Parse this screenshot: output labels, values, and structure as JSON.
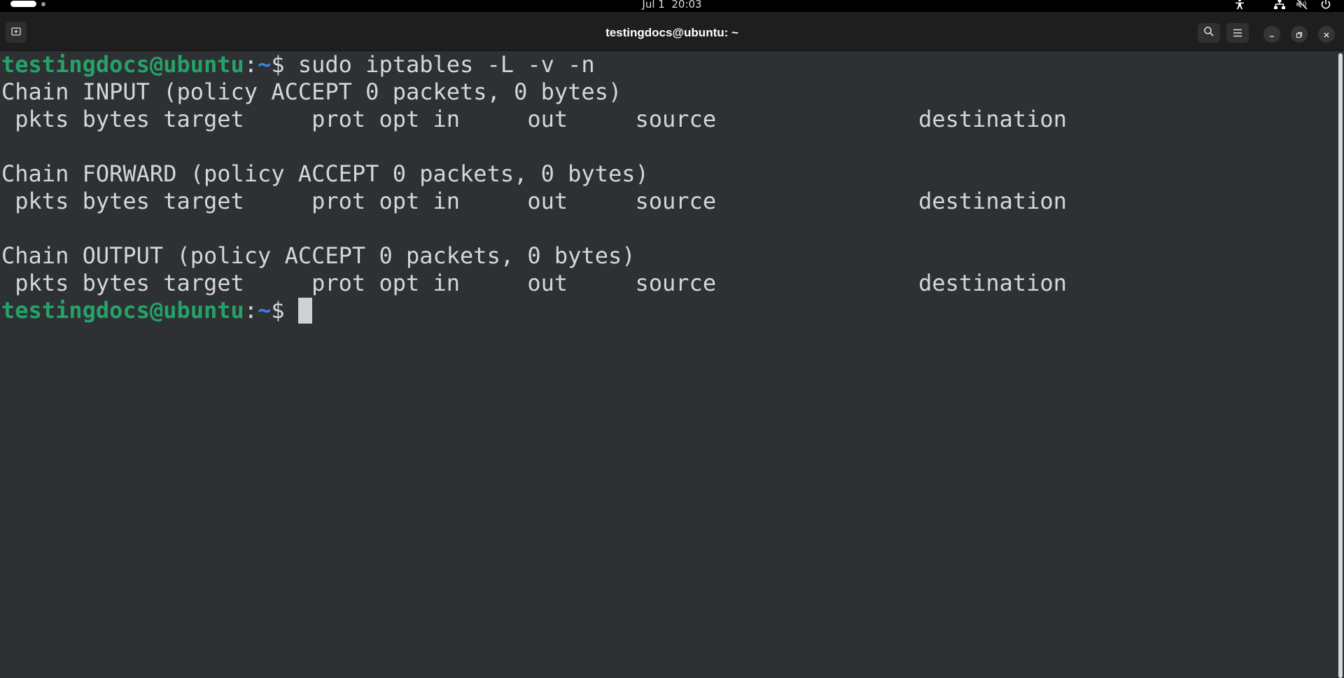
{
  "topbar": {
    "clock": "Jul 1  20:03",
    "tray_icons": [
      "accessibility-icon",
      "network-icon",
      "volume-muted-icon",
      "power-icon"
    ]
  },
  "window": {
    "title": "testingdocs@ubuntu: ~",
    "buttons": [
      "new-tab-icon",
      "search-icon",
      "menu-icon",
      "minimize-icon",
      "restore-icon",
      "close-icon"
    ]
  },
  "terminal": {
    "prompt": {
      "user_host": "testingdocs@ubuntu",
      "colon": ":",
      "path": "~",
      "symbol": "$ "
    },
    "command": "sudo iptables -L -v -n",
    "output": [
      "Chain INPUT (policy ACCEPT 0 packets, 0 bytes)",
      " pkts bytes target     prot opt in     out     source               destination",
      "",
      "Chain FORWARD (policy ACCEPT 0 packets, 0 bytes)",
      " pkts bytes target     prot opt in     out     source               destination",
      "",
      "Chain OUTPUT (policy ACCEPT 0 packets, 0 bytes)",
      " pkts bytes target     prot opt in     out     source               destination"
    ]
  },
  "colors": {
    "terminal_bg": "#2d3134",
    "terminal_fg": "#d6d6d6",
    "prompt_user": "#26a269",
    "prompt_path": "#3584e4",
    "headerbar_bg": "#1e1e1e"
  }
}
